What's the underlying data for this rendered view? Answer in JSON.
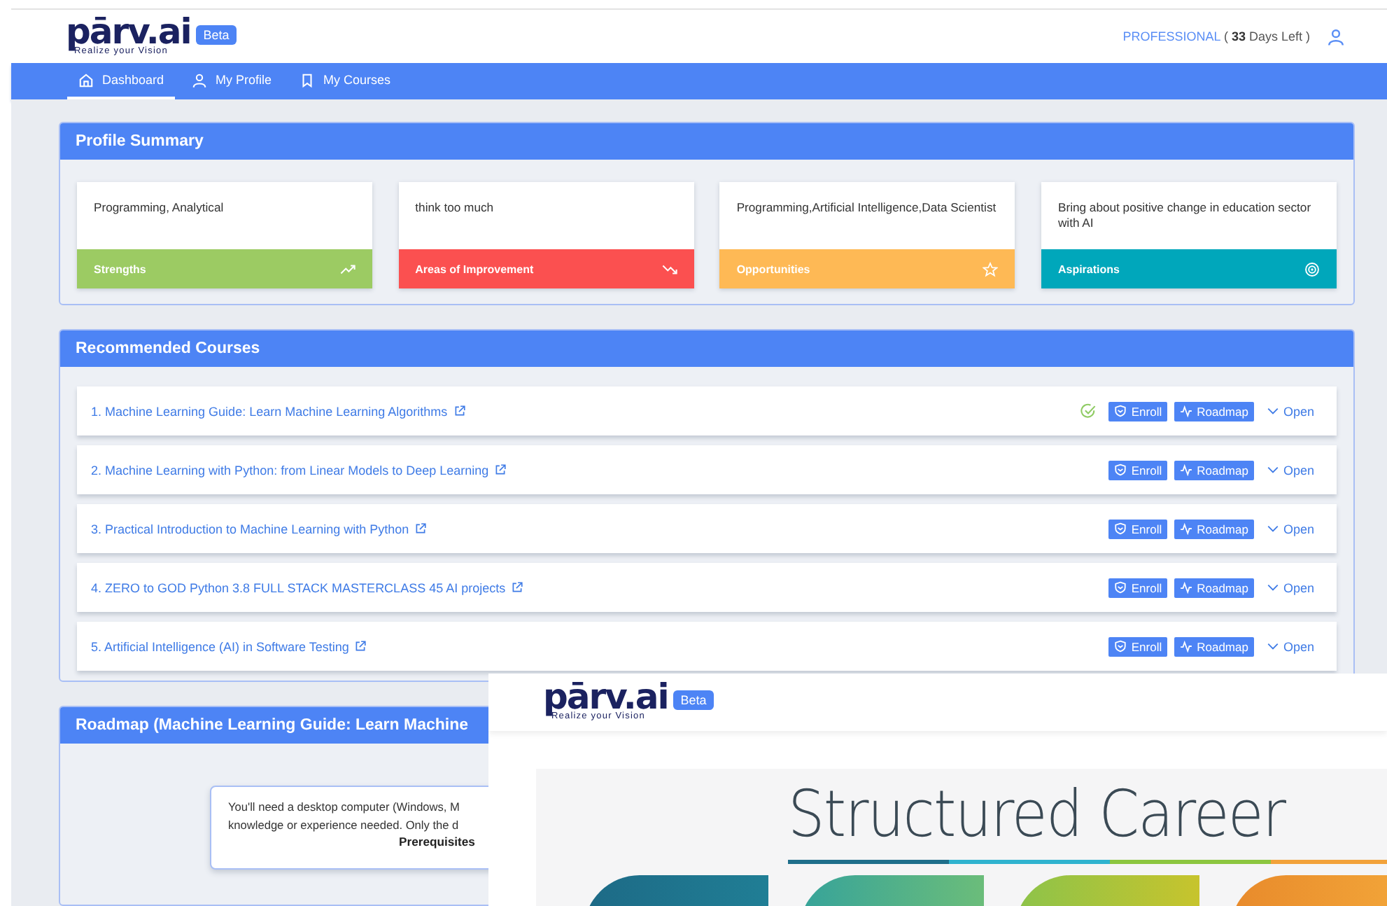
{
  "header": {
    "logo": {
      "wordmark": "pārv.ai",
      "tagline": "Realize your Vision",
      "badge": "Beta"
    },
    "plan": "PROFESSIONAL",
    "days_prefix": "( ",
    "days": "33",
    "days_suffix": " Days Left )"
  },
  "nav": [
    {
      "label": "Dashboard",
      "selected": true
    },
    {
      "label": "My Profile",
      "selected": false
    },
    {
      "label": "My Courses",
      "selected": false
    }
  ],
  "profile_summary": {
    "title": "Profile Summary",
    "cards": [
      {
        "text": "Programming, Analytical",
        "label": "Strengths",
        "color": "#9ccb63"
      },
      {
        "text": "think too much",
        "label": "Areas of Improvement",
        "color": "#fb5050"
      },
      {
        "text": "Programming,Artificial Intelligence,Data Scientist",
        "label": "Opportunities",
        "color": "#feb955"
      },
      {
        "text": "Bring about positive change in education sector with AI",
        "label": "Aspirations",
        "color": "#00a7bb"
      }
    ]
  },
  "recommended_courses": {
    "title": "Recommended Courses",
    "courses": [
      {
        "title": "1. Machine Learning Guide: Learn Machine Learning Algorithms",
        "completed": true,
        "enroll": "Enroll",
        "roadmap": "Roadmap",
        "open": "Open"
      },
      {
        "title": "2. Machine Learning with Python: from Linear Models to Deep Learning",
        "completed": false,
        "enroll": "Enroll",
        "roadmap": "Roadmap",
        "open": "Open"
      },
      {
        "title": "3. Practical Introduction to Machine Learning with Python",
        "completed": false,
        "enroll": "Enroll",
        "roadmap": "Roadmap",
        "open": "Open"
      },
      {
        "title": "4. ZERO to GOD Python 3.8 FULL STACK MASTERCLASS 45 AI projects",
        "completed": false,
        "enroll": "Enroll",
        "roadmap": "Roadmap",
        "open": "Open"
      },
      {
        "title": "5. Artificial Intelligence (AI) in Software Testing",
        "completed": false,
        "enroll": "Enroll",
        "roadmap": "Roadmap",
        "open": "Open"
      }
    ]
  },
  "roadmap": {
    "title": "Roadmap (Machine Learning Guide: Learn Machine",
    "lines": [
      "You'll need a desktop computer (Windows, M",
      "knowledge or experience needed. Only the d"
    ],
    "caption": "Prerequisites"
  },
  "overlay_window": {
    "logo": {
      "wordmark": "pārv.ai",
      "tagline": "Realize your Vision",
      "badge": "Beta"
    },
    "heading": "Structured Career"
  }
}
